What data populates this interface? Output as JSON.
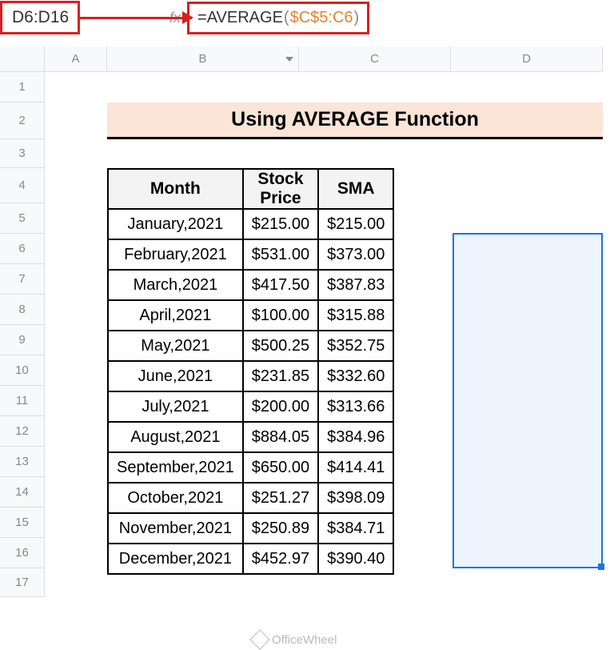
{
  "nameBox": "D6:D16",
  "fxLabel": "fx",
  "formula": {
    "prefix": "=AVERAGE",
    "open": "(",
    "range": "$C$5:C6",
    "close": ")"
  },
  "columns": [
    "A",
    "B",
    "C",
    "D"
  ],
  "rows": [
    "1",
    "2",
    "3",
    "4",
    "5",
    "6",
    "7",
    "8",
    "9",
    "10",
    "11",
    "12",
    "13",
    "14",
    "15",
    "16",
    "17"
  ],
  "title": "Using AVERAGE Function",
  "headers": {
    "month": "Month",
    "price": "Stock Price",
    "sma": "SMA"
  },
  "data": [
    {
      "month": "January,2021",
      "price": "$215.00",
      "sma": "$215.00"
    },
    {
      "month": "February,2021",
      "price": "$531.00",
      "sma": "$373.00"
    },
    {
      "month": "March,2021",
      "price": "$417.50",
      "sma": "$387.83"
    },
    {
      "month": "April,2021",
      "price": "$100.00",
      "sma": "$315.88"
    },
    {
      "month": "May,2021",
      "price": "$500.25",
      "sma": "$352.75"
    },
    {
      "month": "June,2021",
      "price": "$231.85",
      "sma": "$332.60"
    },
    {
      "month": "July,2021",
      "price": "$200.00",
      "sma": "$313.66"
    },
    {
      "month": "August,2021",
      "price": "$884.05",
      "sma": "$384.96"
    },
    {
      "month": "September,2021",
      "price": "$650.00",
      "sma": "$414.41"
    },
    {
      "month": "October,2021",
      "price": "$251.27",
      "sma": "$398.09"
    },
    {
      "month": "November,2021",
      "price": "$250.89",
      "sma": "$384.71"
    },
    {
      "month": "December,2021",
      "price": "$452.97",
      "sma": "$390.40"
    }
  ],
  "watermark": "OfficeWheel"
}
